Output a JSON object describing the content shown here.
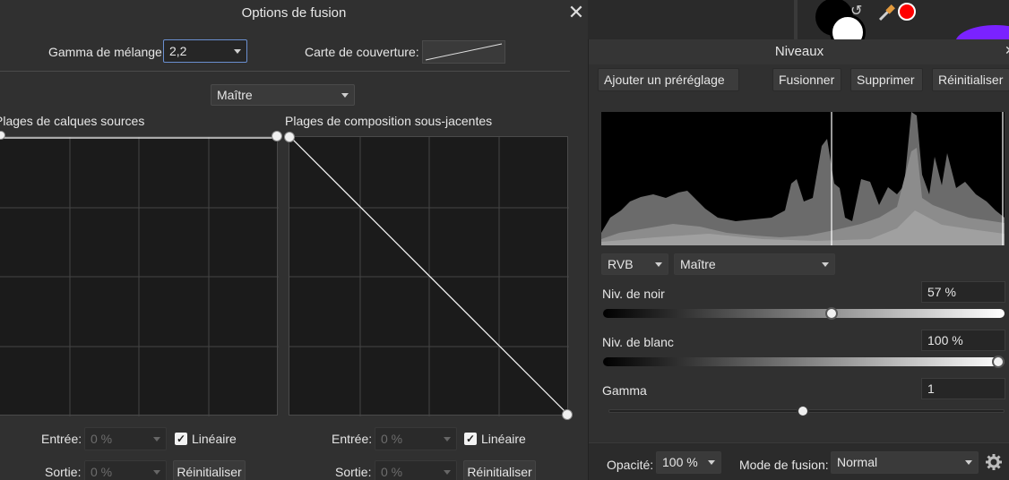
{
  "dialog": {
    "title": "Options de fusion",
    "close_icon": "close-icon",
    "blend_gamma_label": "Gamma de mélange:",
    "blend_gamma_value": "2,2",
    "coverage_map_label": "Carte de couverture:",
    "channel_value": "Maître",
    "source_ranges_label": "Plages de calques sources",
    "underlying_ranges_label": "Plages de composition sous-jacentes",
    "left": {
      "input_label": "Entrée:",
      "input_value": "0 %",
      "output_label": "Sortie:",
      "output_value": "0 %",
      "linear_label": "Linéaire",
      "reset_label": "Réinitialiser"
    },
    "right": {
      "input_label": "Entrée:",
      "input_value": "0 %",
      "output_label": "Sortie:",
      "output_value": "0 %",
      "linear_label": "Linéaire",
      "reset_label": "Réinitialiser"
    }
  },
  "levels": {
    "title": "Niveaux",
    "buttons": {
      "add_preset": "Ajouter un préréglage",
      "merge": "Fusionner",
      "delete": "Supprimer",
      "reset": "Réinitialiser"
    },
    "colorspace": "RVB",
    "channel": "Maître",
    "black_level_label": "Niv. de noir",
    "black_level_value": "57 %",
    "black_level_fraction": 0.57,
    "white_level_label": "Niv. de blanc",
    "white_level_value": "100 %",
    "white_level_fraction": 1.0,
    "gamma_label": "Gamma",
    "gamma_value": "1",
    "opacity_label": "Opacité:",
    "opacity_value": "100 %",
    "blend_mode_label": "Mode de fusion:",
    "blend_mode_value": "Normal",
    "settings_icon": "gear-icon"
  },
  "colors": {
    "primary_fill": "#000000",
    "secondary_fill": "#ffffff",
    "accent_red": "#ff0000"
  }
}
